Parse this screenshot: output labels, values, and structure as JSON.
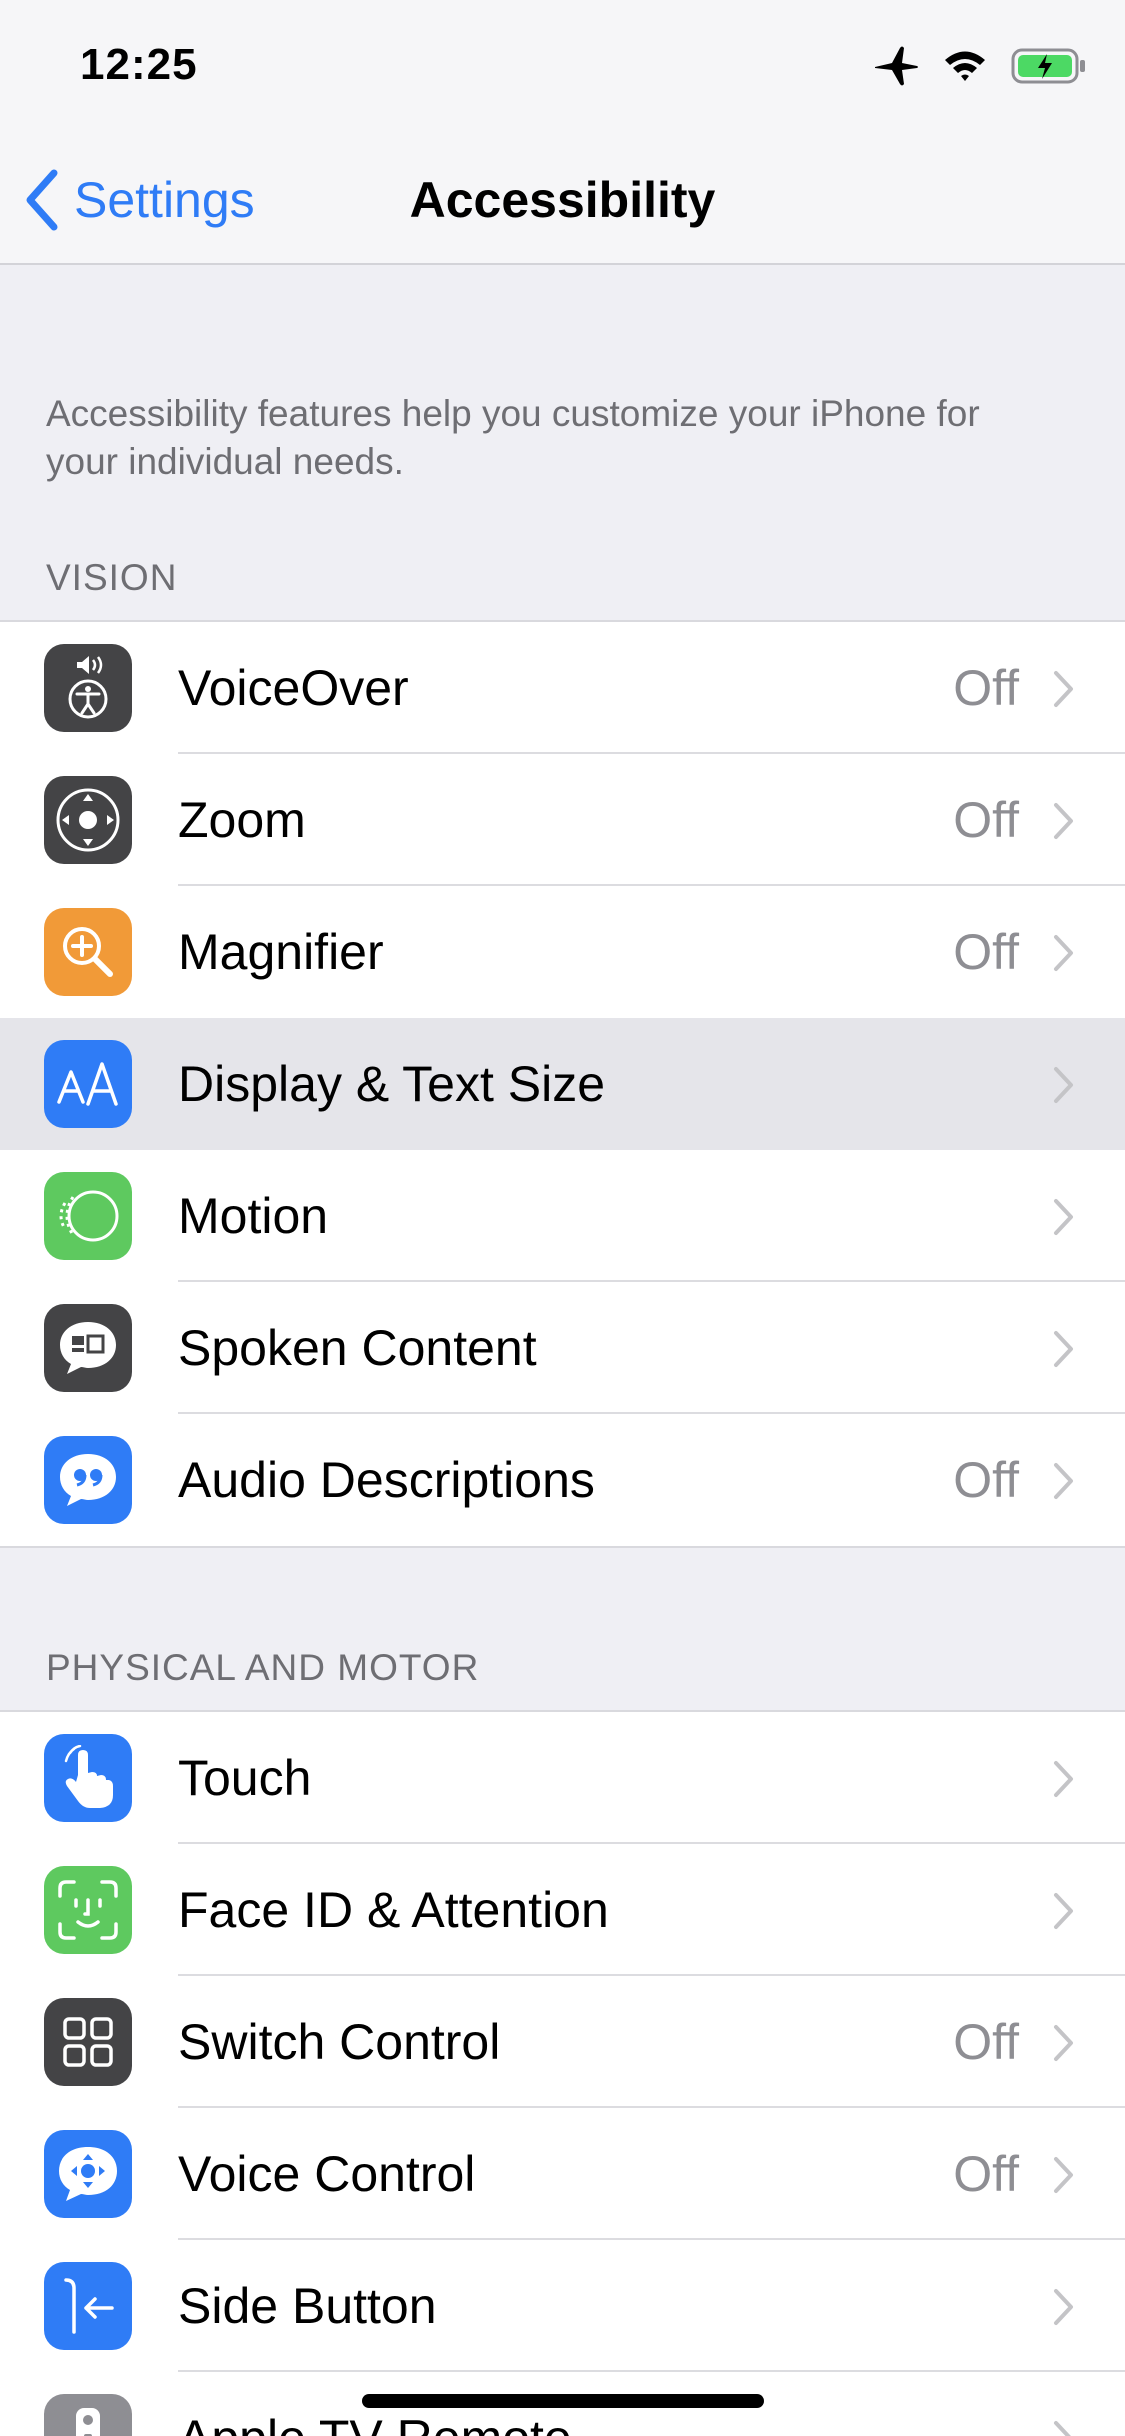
{
  "status_bar": {
    "time": "12:25"
  },
  "nav": {
    "back_label": "Settings",
    "title": "Accessibility"
  },
  "intro_text": "Accessibility features help you customize your iPhone for your individual needs.",
  "sections": {
    "vision": {
      "header": "VISION",
      "items": [
        {
          "label": "VoiceOver",
          "value": "Off",
          "icon": "voiceover-icon",
          "icon_color": "#444446"
        },
        {
          "label": "Zoom",
          "value": "Off",
          "icon": "zoom-icon",
          "icon_color": "#444446"
        },
        {
          "label": "Magnifier",
          "value": "Off",
          "icon": "magnifier-icon",
          "icon_color": "#f19a38"
        },
        {
          "label": "Display & Text Size",
          "value": "",
          "icon": "text-size-icon",
          "icon_color": "#2f7cf6"
        },
        {
          "label": "Motion",
          "value": "",
          "icon": "motion-icon",
          "icon_color": "#5ec95f"
        },
        {
          "label": "Spoken Content",
          "value": "",
          "icon": "speech-bubble-icon",
          "icon_color": "#444446"
        },
        {
          "label": "Audio Descriptions",
          "value": "Off",
          "icon": "quote-bubble-icon",
          "icon_color": "#2f7cf6"
        }
      ]
    },
    "physical": {
      "header": "PHYSICAL AND MOTOR",
      "items": [
        {
          "label": "Touch",
          "value": "",
          "icon": "hand-pointer-icon",
          "icon_color": "#2f7cf6"
        },
        {
          "label": "Face ID & Attention",
          "value": "",
          "icon": "face-id-icon",
          "icon_color": "#5ec95f"
        },
        {
          "label": "Switch Control",
          "value": "Off",
          "icon": "grid-icon",
          "icon_color": "#444446"
        },
        {
          "label": "Voice Control",
          "value": "Off",
          "icon": "voice-control-icon",
          "icon_color": "#2f7cf6"
        },
        {
          "label": "Side Button",
          "value": "",
          "icon": "side-button-icon",
          "icon_color": "#2f7cf6"
        },
        {
          "label": "Apple TV Remote",
          "value": "",
          "icon": "remote-icon",
          "icon_color": "#8e8e93"
        }
      ]
    }
  },
  "colors": {
    "accent": "#2f7cf6",
    "background": "#efeff4",
    "secondary_text": "#8e8e93"
  }
}
